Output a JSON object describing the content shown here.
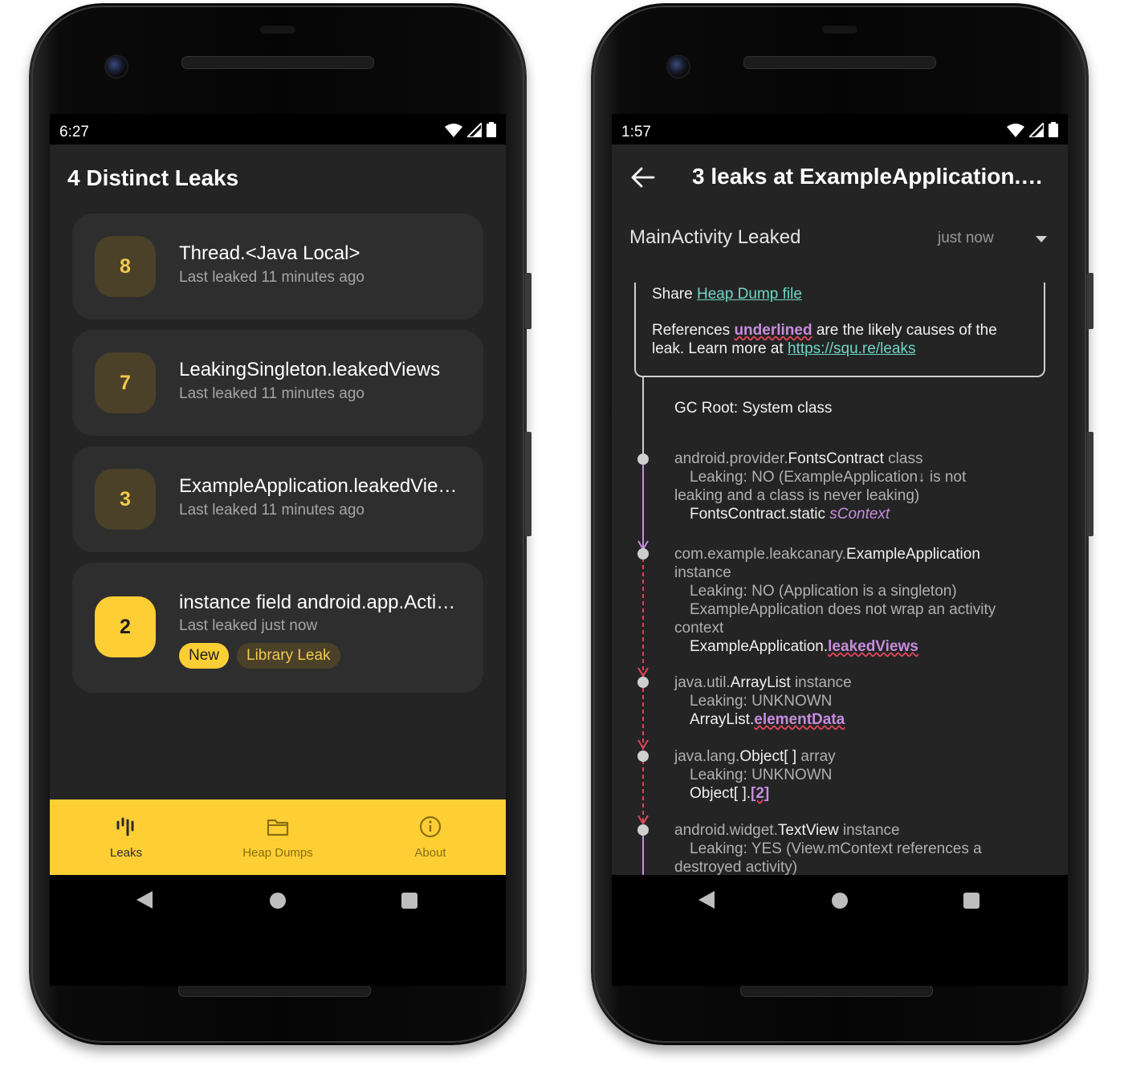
{
  "left_phone": {
    "status_time": "6:27",
    "app_title": "4 Distinct Leaks",
    "leaks": [
      {
        "count": "8",
        "title": "Thread.<Java Local>",
        "subtitle": "Last leaked 11 minutes ago"
      },
      {
        "count": "7",
        "title": "LeakingSingleton.leakedViews",
        "subtitle": "Last leaked 11 minutes ago"
      },
      {
        "count": "3",
        "title": "ExampleApplication.leakedVie…",
        "subtitle": "Last leaked 11 minutes ago"
      },
      {
        "count": "2",
        "title": "instance field android.app.Acti…",
        "subtitle": "Last leaked just now",
        "chips": [
          "New",
          "Library Leak"
        ]
      }
    ],
    "bottom_nav": [
      {
        "label": "Leaks",
        "icon": "leaks-icon",
        "active": true
      },
      {
        "label": "Heap Dumps",
        "icon": "folder-icon",
        "active": false
      },
      {
        "label": "About",
        "icon": "info-icon",
        "active": false
      }
    ]
  },
  "right_phone": {
    "status_time": "1:57",
    "toolbar_title": "3 leaks at ExampleApplication.le…",
    "leak_header": "MainActivity Leaked",
    "leak_time": "just now",
    "info": {
      "share_prefix": "Share ",
      "share_link": "Heap Dump file",
      "refs_prefix": "References ",
      "refs_underlined": "underlined",
      "refs_middle": " are the likely causes of the leak. Learn more at ",
      "refs_link": "https://squ.re/leaks"
    },
    "gc_root": "GC Root: System class",
    "nodes": [
      {
        "pkg": "android.provider.",
        "cls": "FontsContract",
        "kind": " class",
        "leaking": "Leaking: NO (ExampleApplication↓ is not",
        "leaking_cont": "leaking and a class is never leaking)",
        "ref_owner": "FontsContract.static ",
        "ref_field": "sContext"
      },
      {
        "pkg": "com.example.leakcanary.",
        "cls": "ExampleApplication",
        "kind": "instance",
        "leaking": "Leaking: NO (Application is a singleton)",
        "extra": "ExampleApplication does not wrap an activity",
        "extra_cont": "context",
        "ref_owner": "ExampleApplication.",
        "ref_field": "leakedViews"
      },
      {
        "pkg": "java.util.",
        "cls": "ArrayList",
        "kind": " instance",
        "leaking": "Leaking: UNKNOWN",
        "ref_owner": "ArrayList.",
        "ref_field": "elementData"
      },
      {
        "pkg": "java.lang.",
        "cls": "Object[ ]",
        "kind": " array",
        "leaking": "Leaking: UNKNOWN",
        "ref_owner": "Object[ ].",
        "ref_field": "[2]"
      },
      {
        "pkg": "android.widget.",
        "cls": "TextView",
        "kind": " instance",
        "leaking": "Leaking: YES (View.mContext references a",
        "leaking_cont": "destroyed activity)"
      }
    ]
  },
  "colors": {
    "accent_yellow": "#fdcf35",
    "badge_dark": "#4a4128",
    "link_teal": "#6fd6c6",
    "ref_purple": "#c68dde",
    "leak_red": "#e0465a"
  }
}
